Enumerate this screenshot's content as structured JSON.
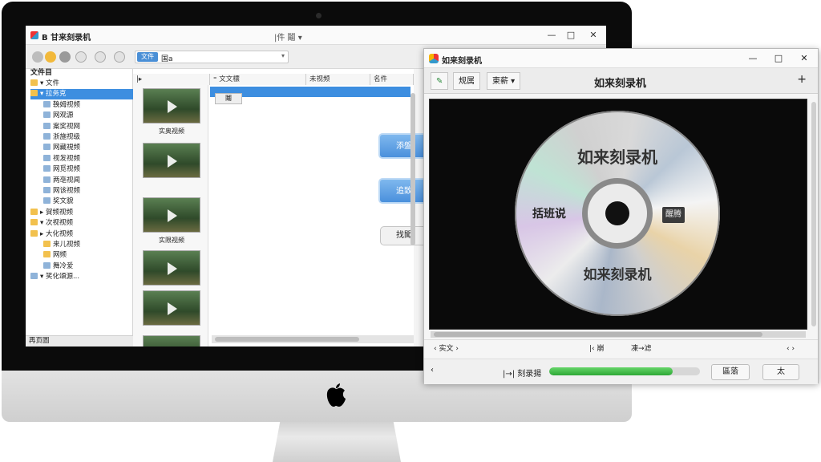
{
  "main_window": {
    "title": "B 甘来刻录机",
    "menu_center": "|件  鬮 ▾",
    "controls": {
      "minimize": "—",
      "maximize": "□",
      "close": "✕"
    },
    "address": {
      "chip": "文件",
      "path": "国a",
      "arrow": "▾"
    },
    "tree": {
      "header": "文件目",
      "items": [
        {
          "label": "▾ 文件",
          "icon": "folder-icon"
        },
        {
          "label": "▾ 拉务克",
          "icon": "folder-icon",
          "selected": true
        },
        {
          "label": "鞔姆视频",
          "icon": "media-icon"
        },
        {
          "label": "网观源",
          "icon": "media-icon"
        },
        {
          "label": "案奖视网",
          "icon": "media-icon"
        },
        {
          "label": "浙施视级",
          "icon": "media-icon"
        },
        {
          "label": "网藏視频",
          "icon": "media-icon"
        },
        {
          "label": "视发视频",
          "icon": "media-icon"
        },
        {
          "label": "网觅视频",
          "icon": "media-icon"
        },
        {
          "label": "两亳视闻",
          "icon": "media-icon"
        },
        {
          "label": "网该视频",
          "icon": "media-icon"
        },
        {
          "label": "奖文貌",
          "icon": "media-icon"
        },
        {
          "label": "▸ 賀频视频",
          "icon": "folder-icon"
        },
        {
          "label": "▾ 次视视频",
          "icon": "folder-icon"
        },
        {
          "label": "▸ 大化视频",
          "icon": "folder-icon"
        },
        {
          "label": "来儿视频",
          "icon": "folder-icon"
        },
        {
          "label": "网频",
          "icon": "folder-icon"
        },
        {
          "label": "舞冷爱",
          "icon": "media-icon"
        },
        {
          "label": "▾ 笑化頌源...",
          "icon": "media-icon"
        }
      ],
      "status": "再页圖"
    },
    "file_list": {
      "columns": [
        "|▸",
        "⁼ 文文標",
        "未视频",
        "名件"
      ],
      "drag_chip": "鬮",
      "thumbs": [
        {
          "label": "实奥视频"
        },
        {
          "label": ""
        },
        {
          "label": "实限视频"
        },
        {
          "label": ""
        },
        {
          "label": ""
        },
        {
          "label": ""
        }
      ]
    },
    "side_buttons": {
      "primary": "添盤",
      "secondary": "追致",
      "tertiary": "找闖"
    }
  },
  "burner_window": {
    "title": "如来刻录机",
    "controls": {
      "minimize": "—",
      "maximize": "□",
      "close": "✕"
    },
    "tabs": [
      "✎",
      "规属",
      "東薪 ▾"
    ],
    "heading": "如来刻录机",
    "add": "+",
    "disc": {
      "top_text": "如来刻录机",
      "bottom_text": "如来刻录机",
      "left_text": "括班说",
      "right_badge": "醒腾"
    },
    "info_row": {
      "left": "‹ 实文 ›",
      "center_left": "|‹ 崩",
      "center_right": "凍→滤",
      "right": "‹ ›"
    },
    "status": {
      "label": "|→|  刻录揚",
      "progress_percent": 82,
      "button_1": "區蕍",
      "button_2": "太"
    },
    "colors": {
      "progress": "#2ea836",
      "accent": "#3d8ee0"
    }
  }
}
